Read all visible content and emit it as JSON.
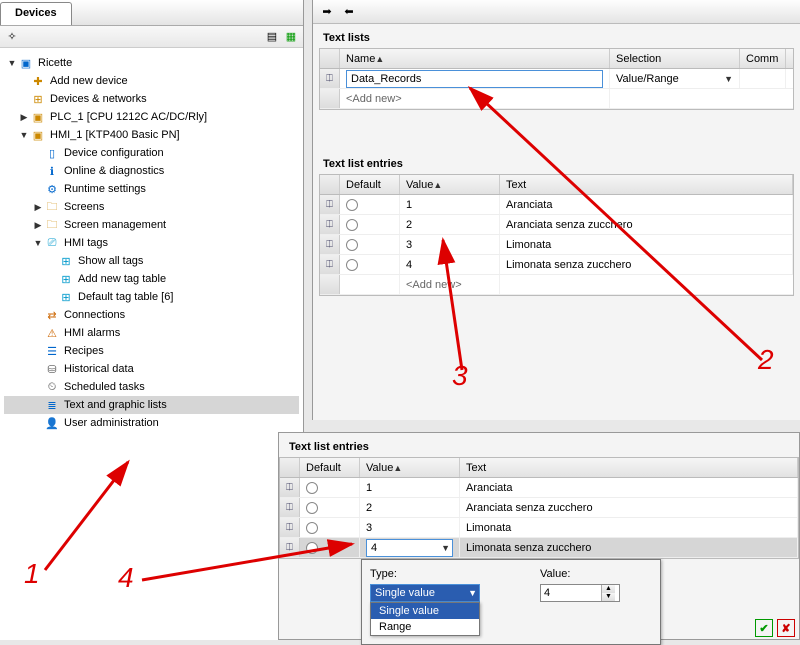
{
  "left": {
    "tab": "Devices",
    "tree": {
      "root": "Ricette",
      "items": [
        "Add new device",
        "Devices & networks",
        "PLC_1 [CPU 1212C AC/DC/Rly]",
        "HMI_1 [KTP400 Basic PN]",
        "Device configuration",
        "Online & diagnostics",
        "Runtime settings",
        "Screens",
        "Screen management",
        "HMI tags",
        "Show all tags",
        "Add new tag table",
        "Default tag table [6]",
        "Connections",
        "HMI alarms",
        "Recipes",
        "Historical data",
        "Scheduled tasks",
        "Text and graphic lists",
        "User administration"
      ]
    }
  },
  "top": {
    "section1": "Text lists",
    "cols1": {
      "name": "Name",
      "sel": "Selection",
      "comm": "Comm"
    },
    "row_name": "Data_Records",
    "row_sel": "Value/Range",
    "addnew": "<Add new>",
    "section2": "Text list entries",
    "cols2": {
      "def": "Default",
      "val": "Value",
      "txt": "Text"
    },
    "entries": [
      {
        "v": "1",
        "t": "Aranciata"
      },
      {
        "v": "2",
        "t": "Aranciata senza zucchero"
      },
      {
        "v": "3",
        "t": "Limonata"
      },
      {
        "v": "4",
        "t": "Limonata senza zucchero"
      }
    ]
  },
  "bottom": {
    "title": "Text list entries",
    "cols": {
      "def": "Default",
      "val": "Value",
      "txt": "Text"
    },
    "active_value": "4",
    "type_label": "Type:",
    "value_label": "Value:",
    "type_dropdown": {
      "selected": "Single value",
      "options": [
        "Single value",
        "Range"
      ]
    },
    "spin_value": "4"
  },
  "annot": {
    "a1": "1",
    "a2": "2",
    "a3": "3",
    "a4": "4"
  }
}
